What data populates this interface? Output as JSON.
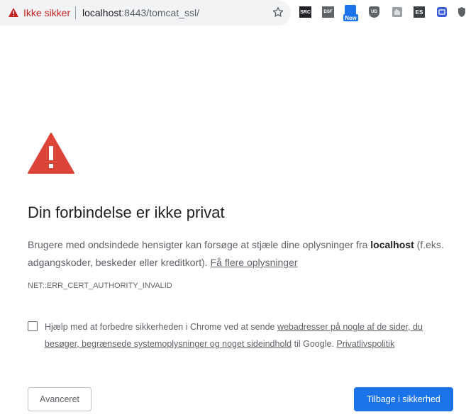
{
  "browser": {
    "security_label": "Ikke sikker",
    "url_host": "localhost",
    "url_rest": ":8443/tomcat_ssl/",
    "extensions": [
      "SRC",
      "DSF",
      "New",
      "UD",
      "ES"
    ]
  },
  "page": {
    "title": "Din forbindelse er ikke privat",
    "desc_part1": "Brugere med ondsindede hensigter kan forsøge at stjæle dine oplysninger fra ",
    "desc_host": "localhost",
    "desc_part2": " (f.eks. adgangskoder, beskeder eller kreditkort). ",
    "learn_more": "Få flere oplysninger",
    "error_code": "NET::ERR_CERT_AUTHORITY_INVALID",
    "optin_part1": "Hjælp med at forbedre sikkerheden i Chrome ved at sende ",
    "optin_link": "webadresser på nogle af de sider, du besøger, begrænsede systemoplysninger og noget sideindhold",
    "optin_part2": " til Google. ",
    "privacy_link": "Privatlivspolitik",
    "advanced_button": "Avanceret",
    "back_button": "Tilbage i sikkerhed"
  },
  "colors": {
    "danger": "#c5221f",
    "warning_red": "#db4437",
    "primary": "#1a73e8"
  }
}
